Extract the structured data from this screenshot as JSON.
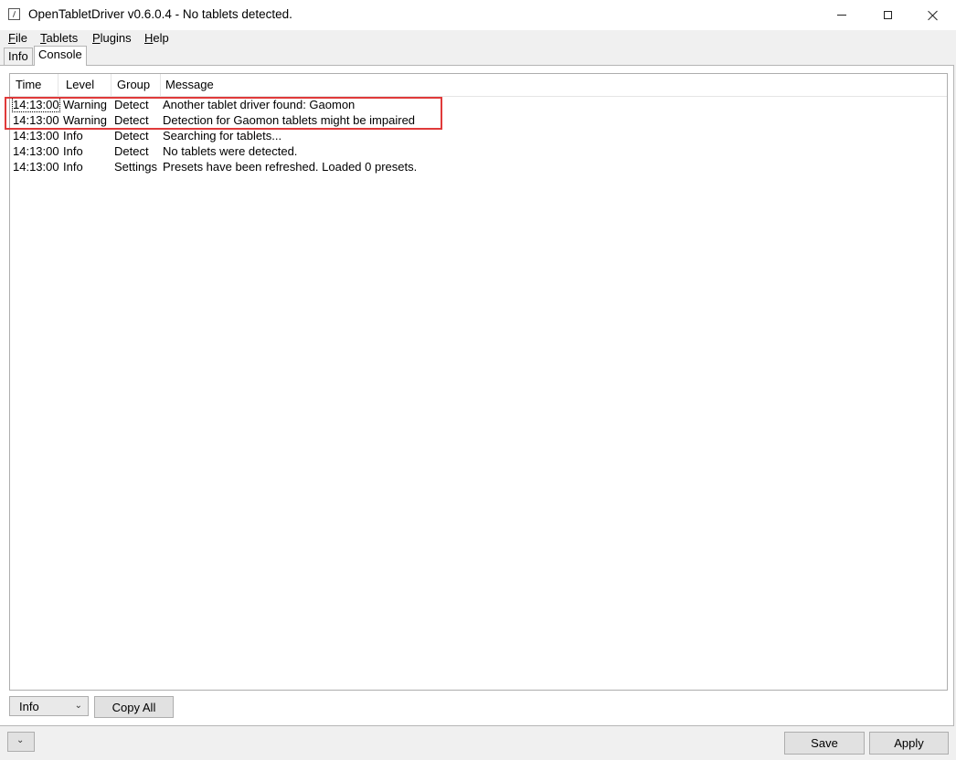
{
  "window": {
    "title": "OpenTabletDriver v0.6.0.4 - No tablets detected."
  },
  "menu": {
    "file": {
      "accel": "F",
      "rest": "ile"
    },
    "tablets": {
      "accel": "T",
      "rest": "ablets"
    },
    "plugins": {
      "accel": "P",
      "rest": "lugins"
    },
    "help": {
      "accel": "H",
      "rest": "elp"
    }
  },
  "tabs": {
    "info": "Info",
    "console": "Console"
  },
  "console": {
    "columns": [
      "Time",
      "Level",
      "Group",
      "Message"
    ],
    "rows": [
      {
        "time": "14:13:00",
        "level": "Warning",
        "group": "Detect",
        "message": "Another tablet driver found: Gaomon"
      },
      {
        "time": "14:13:00",
        "level": "Warning",
        "group": "Detect",
        "message": "Detection for Gaomon tablets might be impaired"
      },
      {
        "time": "14:13:00",
        "level": "Info",
        "group": "Detect",
        "message": "Searching for tablets..."
      },
      {
        "time": "14:13:00",
        "level": "Info",
        "group": "Detect",
        "message": "No tablets were detected."
      },
      {
        "time": "14:13:00",
        "level": "Info",
        "group": "Settings",
        "message": "Presets have been refreshed. Loaded 0 presets."
      }
    ]
  },
  "controls": {
    "level_filter": "Info",
    "copy_all": "Copy All",
    "save": "Save",
    "apply": "Apply"
  },
  "colors": {
    "annotation_box": "#e03a3a"
  },
  "icons": {
    "app": "app-icon",
    "minimize": "minimize-icon",
    "maximize": "maximize-icon",
    "close": "close-icon",
    "dropdown": "chevron-down-icon"
  }
}
